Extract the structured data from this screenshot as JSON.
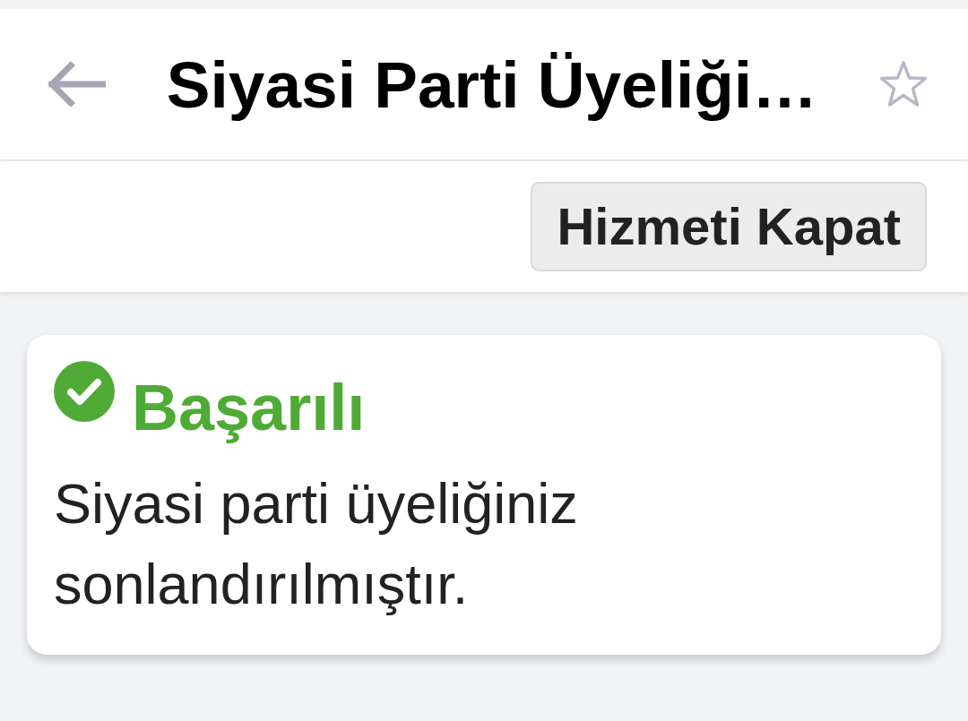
{
  "header": {
    "title": "Siyasi Parti Üyeliği…",
    "starred": false
  },
  "toolbar": {
    "buttons": [
      "Hizmeti Kapat"
    ]
  },
  "alert": {
    "kind": "success",
    "title": "Başarılı",
    "message": "Siyasi parti üyeliğiniz sonlandırılmıştır."
  }
}
